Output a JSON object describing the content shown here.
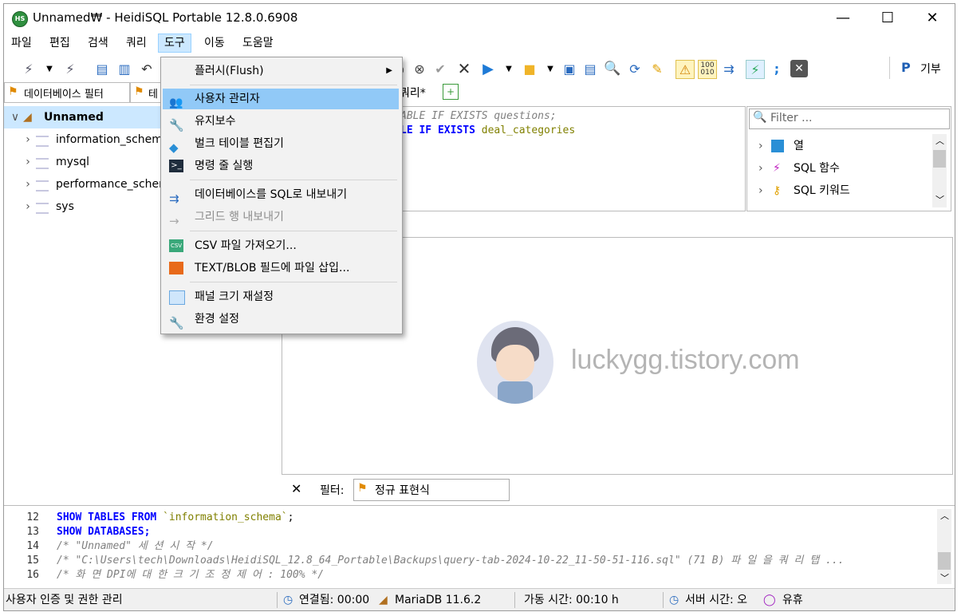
{
  "window": {
    "title": "Unnamed₩ - HeidiSQL Portable 12.8.0.6908",
    "app_icon_text": "HS",
    "minimize": "—",
    "maximize": "☐",
    "close": "✕"
  },
  "menubar": [
    "파일",
    "편집",
    "검색",
    "쿼리",
    "도구",
    "이동",
    "도움말"
  ],
  "toolbar": {
    "donate_label": "기부"
  },
  "tabs": {
    "db_filter": "데이터베이스 필터",
    "table_filter_short": "테",
    "query_tab": "쿼리*"
  },
  "tree": [
    {
      "label": "Unnamed",
      "selected": true
    },
    {
      "label": "information_schem"
    },
    {
      "label": "mysql"
    },
    {
      "label": "performance_scher"
    },
    {
      "label": "sys"
    }
  ],
  "editor": {
    "line1": "ABLE IF EXISTS questions;",
    "line2_kw1": "LE",
    "line2_kw2": "IF",
    "line2_kw3": "EXISTS",
    "line2_ident": "deal_categories"
  },
  "helper": {
    "filter_placeholder": "Filter ...",
    "items": [
      "열",
      "SQL 함수",
      "SQL 키워드"
    ]
  },
  "result": {
    "watermark": "luckygg.tistory.com"
  },
  "filterbar": {
    "close": "✕",
    "label": "필터:",
    "regex_label": "정규 표현식"
  },
  "log": [
    {
      "num": "12",
      "parts": [
        [
          "kw",
          "SHOW TABLES FROM "
        ],
        [
          "str",
          "`information_schema`"
        ],
        [
          "plain",
          ";"
        ]
      ]
    },
    {
      "num": "13",
      "parts": [
        [
          "kw",
          "SHOW DATABASES;"
        ]
      ]
    },
    {
      "num": "14",
      "parts": [
        [
          "cm",
          "/* \"Unnamed\" 세 션  시 작  */"
        ]
      ]
    },
    {
      "num": "15",
      "parts": [
        [
          "cm",
          "/* \"C:\\Users\\tech\\Downloads\\HeidiSQL_12.8_64_Portable\\Backups\\query-tab-2024-10-22_11-50-51-116.sql\" (71 B) 파 일 을  쿼 리  탭 ..."
        ]
      ]
    },
    {
      "num": "16",
      "parts": [
        [
          "cm",
          "/* 화 면  DPI에  대 한  크 기 조 정  제 어 : 100% */"
        ]
      ]
    }
  ],
  "statusbar": {
    "hint": "사용자 인증 및 권한 관리",
    "connected": "연결됨: 00:00",
    "server": "MariaDB 11.6.2",
    "uptime": "가동 시간: 00:10 h",
    "server_time": "서버 시간: 오",
    "idle": "유휴"
  },
  "tools_menu": {
    "flush": "플러시(Flush)",
    "user_manager": "사용자 관리자",
    "maintenance": "유지보수",
    "bulk_table_editor": "벌크 테이블 편집기",
    "run_command": "명령 줄 실행",
    "export_sql": "데이터베이스를 SQL로 내보내기",
    "export_grid": "그리드 행 내보내기",
    "import_csv": "CSV 파일 가져오기...",
    "insert_file": "TEXT/BLOB 필드에 파일 삽입...",
    "reset_panels": "패널 크기 재설정",
    "preferences": "환경 설정"
  }
}
